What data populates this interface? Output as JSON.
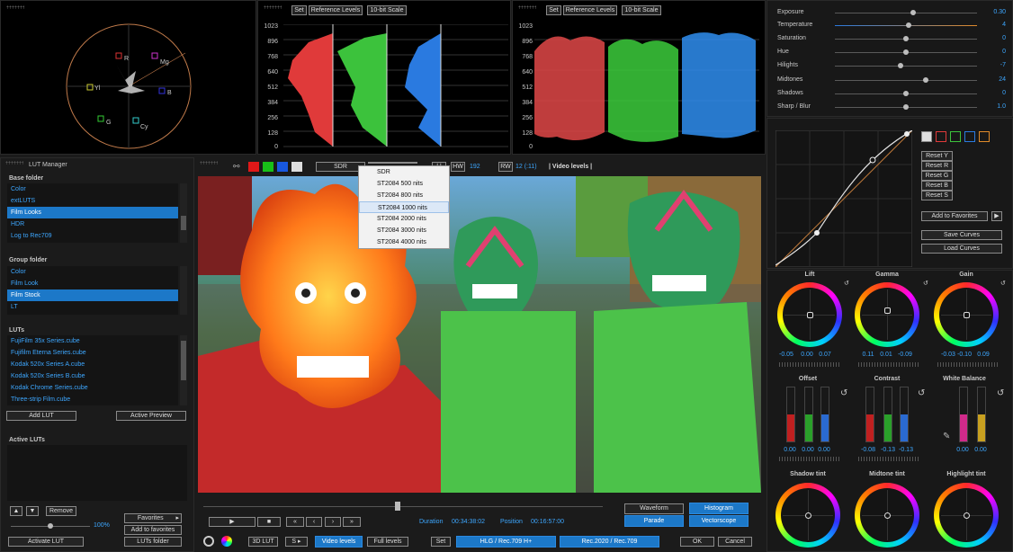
{
  "scopes": {
    "set_label": "Set",
    "reference_label": "Reference Levels",
    "bit_label": "10-bit Scale",
    "axis": [
      "1023",
      "896",
      "768",
      "640",
      "512",
      "384",
      "256",
      "128",
      "0"
    ],
    "vectorscope_labels": [
      "R",
      "Mg",
      "B",
      "Cy",
      "G",
      "Yl"
    ]
  },
  "lut_manager": {
    "title": "LUT Manager",
    "base_folder": {
      "title": "Base folder",
      "items": [
        "Color",
        "extLUTS",
        "Film Looks",
        "HDR",
        "Log to Rec709"
      ],
      "selected": 2
    },
    "group_folder": {
      "title": "Group folder",
      "items": [
        "Color",
        "Film Look",
        "Film Stock",
        "LT"
      ],
      "selected": 2
    },
    "luts": {
      "title": "LUTs",
      "items": [
        "FujiFilm 35x Series.cube",
        "Fujifilm Eterna Series.cube",
        "Kodak 520x Series A.cube",
        "Kodak 520x Series B.cube",
        "Kodak Chrome Series.cube",
        "Three-strip Film.cube"
      ]
    },
    "add_lut": "Add LUT",
    "active_preview": "Active Preview",
    "active_luts_title": "Active LUTs",
    "remove": "Remove",
    "zoom": "100%",
    "favorites": "Favorites",
    "add_to_favorites": "Add to favorites",
    "activate_lut": "Activate LUT",
    "luts_folder": "LUTs folder"
  },
  "viewer_toolbar": {
    "sdr": "SDR",
    "hw": "HW",
    "hw_value": "192",
    "rw": "RW",
    "rw_value": "12 (:11)",
    "video_levels": "| Video levels |",
    "dropdown_options": [
      "SDR",
      "ST2084 500 nits",
      "ST2084 800 nits",
      "ST2084 1000 nits",
      "ST2084 2000 nits",
      "ST2084 3000 nits",
      "ST2084 4000 nits"
    ],
    "dropdown_highlight": 3
  },
  "transport": {
    "duration_label": "Duration",
    "duration_value": "00:34:38:02",
    "position_label": "Position",
    "position_value": "00:16:57:00",
    "waveform": "Waveform",
    "histogram": "Histogram",
    "parade": "Parade",
    "vectorscope": "Vectorscope"
  },
  "bottom_bar": {
    "lut3d": "3D LUT",
    "s": "S",
    "video_levels": "Video levels",
    "full_levels": "Full levels",
    "set": "Set",
    "hlg": "HLG / Rec.709 H+",
    "rec2020": "Rec.2020 / Rec.709",
    "ok": "OK",
    "cancel": "Cancel"
  },
  "adjustments": [
    {
      "label": "Exposure",
      "value": "0.30",
      "pos": 0.55
    },
    {
      "label": "Temperature",
      "value": "4",
      "pos": 0.52
    },
    {
      "label": "Saturation",
      "value": "0",
      "pos": 0.5
    },
    {
      "label": "Hue",
      "value": "0",
      "pos": 0.5
    },
    {
      "label": "Hilights",
      "value": "-7",
      "pos": 0.46
    },
    {
      "label": "Midtones",
      "value": "24",
      "pos": 0.64
    },
    {
      "label": "Shadows",
      "value": "0",
      "pos": 0.5
    },
    {
      "label": "Sharp / Blur",
      "value": "1.0",
      "pos": 0.5
    }
  ],
  "curves": {
    "reset_y": "Reset Y",
    "reset_r": "Reset R",
    "reset_g": "Reset G",
    "reset_b": "Reset B",
    "reset_s": "Reset S",
    "add_to_favorites": "Add to Favorites",
    "save_curves": "Save Curves",
    "load_curves": "Load Curves"
  },
  "wheels": {
    "lift": {
      "label": "Lift",
      "values": [
        "-0.05",
        "0.00",
        "0.07"
      ]
    },
    "gamma": {
      "label": "Gamma",
      "values": [
        "0.11",
        "0.01",
        "-0.09"
      ]
    },
    "gain": {
      "label": "Gain",
      "values": [
        "-0.03",
        "-0.10",
        "0.09"
      ]
    },
    "shadow": {
      "label": "Shadow tint"
    },
    "midtone": {
      "label": "Midtone tint"
    },
    "highlight": {
      "label": "Highlight tint"
    }
  },
  "bars": {
    "offset": {
      "label": "Offset",
      "values": [
        "0.00",
        "0.00",
        "0.00"
      ]
    },
    "contrast": {
      "label": "Contrast",
      "values": [
        "-0.08",
        "-0.13",
        "-0.13"
      ]
    },
    "white_balance": {
      "label": "White Balance",
      "values": [
        "0.00",
        "0.00"
      ]
    }
  },
  "colors": {
    "accent": "#1c78c8",
    "value_blue": "#3da7ff"
  }
}
